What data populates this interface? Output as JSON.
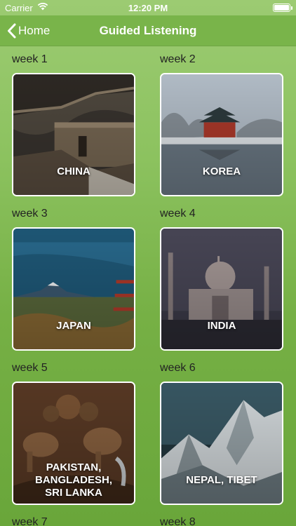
{
  "status_bar": {
    "carrier": "Carrier",
    "time": "12:20 PM"
  },
  "nav": {
    "back_label": "Home",
    "title": "Guided Listening"
  },
  "weeks": [
    {
      "label": "week 1",
      "country": "CHINA"
    },
    {
      "label": "week 2",
      "country": "KOREA"
    },
    {
      "label": "week 3",
      "country": "JAPAN"
    },
    {
      "label": "week 4",
      "country": "INDIA"
    },
    {
      "label": "week 5",
      "country": "PAKISTAN,\nBANGLADESH,\nSRI LANKA"
    },
    {
      "label": "week 6",
      "country": "NEPAL, TIBET"
    },
    {
      "label": "week 7",
      "country": ""
    },
    {
      "label": "week 8",
      "country": ""
    }
  ],
  "colors": {
    "accent": "#79b44a",
    "background_top": "#9ccb72",
    "background_bottom": "#69a63a"
  }
}
